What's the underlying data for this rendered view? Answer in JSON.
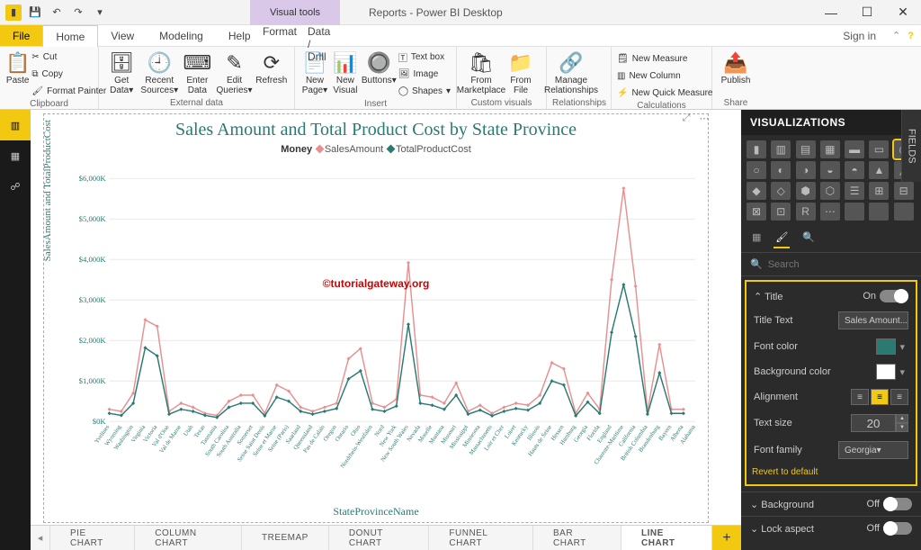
{
  "app": {
    "visual_tools": "Visual tools",
    "title": "Reports - Power BI Desktop",
    "signin": "Sign in"
  },
  "tabs": {
    "file": "File",
    "home": "Home",
    "view": "View",
    "modeling": "Modeling",
    "help": "Help",
    "format": "Format",
    "datadrill": "Data / Drill"
  },
  "ribbon": {
    "clipboard": {
      "label": "Clipboard",
      "paste": "Paste",
      "cut": "Cut",
      "copy": "Copy",
      "format_painter": "Format Painter"
    },
    "external": {
      "label": "External data",
      "get_data": "Get Data",
      "recent": "Recent Sources",
      "enter": "Enter Data",
      "edit": "Edit Queries",
      "refresh": "Refresh"
    },
    "insert": {
      "label": "Insert",
      "new_page": "New Page",
      "new_visual": "New Visual",
      "buttons": "Buttons",
      "text_box": "Text box",
      "image": "Image",
      "shapes": "Shapes"
    },
    "custom": {
      "label": "Custom visuals",
      "marketplace": "From Marketplace",
      "file": "From File"
    },
    "rel": {
      "label": "Relationships",
      "manage": "Manage Relationships"
    },
    "calc": {
      "label": "Calculations",
      "new_measure": "New Measure",
      "new_column": "New Column",
      "quick": "New Quick Measure"
    },
    "share": {
      "label": "Share",
      "publish": "Publish"
    }
  },
  "sheets": [
    "PIE CHART",
    "COLUMN CHART",
    "TREEMAP",
    "DONUT CHART",
    "FUNNEL CHART",
    "BAR CHART",
    "LINE CHART"
  ],
  "viz_pane": {
    "header": "VISUALIZATIONS",
    "search": "Search"
  },
  "fields_tab": "FIELDS",
  "format": {
    "title_section": "Title",
    "title_on": "On",
    "title_text_label": "Title Text",
    "title_text_value": "Sales Amount...",
    "font_color": "Font color",
    "font_color_value": "#2a7a72",
    "bg_color": "Background color",
    "bg_color_value": "#ffffff",
    "alignment": "Alignment",
    "text_size": "Text size",
    "text_size_value": "20",
    "font_family": "Font family",
    "font_family_value": "Georgia",
    "revert": "Revert to default",
    "background": "Background",
    "background_state": "Off",
    "lock": "Lock aspect",
    "lock_state": "Off"
  },
  "chart_data": {
    "type": "line",
    "title": "Sales Amount and Total Product Cost by State Province",
    "legend_label": "Money",
    "series": [
      {
        "name": "SalesAmount",
        "color": "#e89090",
        "values": [
          300,
          250,
          700,
          2510,
          2350,
          250,
          450,
          350,
          200,
          150,
          500,
          650,
          650,
          200,
          900,
          750,
          350,
          250,
          350,
          450,
          1550,
          1800,
          450,
          350,
          550,
          3920,
          650,
          600,
          450,
          950,
          250,
          400,
          200,
          350,
          450,
          400,
          650,
          1450,
          1300,
          200,
          700,
          300,
          3500,
          5760,
          3340,
          250,
          1900,
          300,
          300
        ]
      },
      {
        "name": "TotalProductCost",
        "color": "#2a7a72",
        "values": [
          200,
          150,
          450,
          1820,
          1620,
          180,
          300,
          250,
          150,
          100,
          350,
          450,
          450,
          140,
          600,
          500,
          250,
          180,
          250,
          320,
          1050,
          1250,
          300,
          250,
          380,
          2400,
          450,
          400,
          300,
          650,
          180,
          280,
          140,
          250,
          320,
          280,
          450,
          1000,
          900,
          140,
          480,
          200,
          2200,
          3380,
          2100,
          180,
          1200,
          200,
          200
        ]
      }
    ],
    "categories": [
      "Yvelines",
      "Wyoming",
      "Washington",
      "Virginia",
      "Victoria",
      "Val d'Oise",
      "Val de Marne",
      "Utah",
      "Texas",
      "Tasmania",
      "South Carolina",
      "South Australia",
      "Somerset",
      "Seine Saint Denis",
      "Seine et Marne",
      "Seine (Paris)",
      "Saarland",
      "Queensland",
      "Pas de Calais",
      "Oregon",
      "Ontario",
      "Ohio",
      "Nordrhein-Westfalen",
      "Nord",
      "New York",
      "New South Wales",
      "Nevada",
      "Moselle",
      "Montana",
      "Missouri",
      "Mississippi",
      "Minnesota",
      "Massachusetts",
      "Loir et Cher",
      "Loiret",
      "Kentucky",
      "Illinois",
      "Hauts de Seine",
      "Hessen",
      "Hamburg",
      "Georgia",
      "Florida",
      "England",
      "Charente-Maritime",
      "California",
      "British Columbia",
      "Brandenburg",
      "Bayern",
      "Alberta",
      "Alabama"
    ],
    "xlabel": "StateProvinceName",
    "ylabel": "SalesAmount and TotalProductCost",
    "ylim": [
      0,
      6000
    ],
    "yticks": [
      0,
      1000,
      2000,
      3000,
      4000,
      5000,
      6000
    ],
    "ytick_labels": [
      "$0K",
      "$1,000K",
      "$2,000K",
      "$3,000K",
      "$4,000K",
      "$5,000K",
      "$6,000K"
    ],
    "watermark": "©tutorialgateway.org"
  }
}
